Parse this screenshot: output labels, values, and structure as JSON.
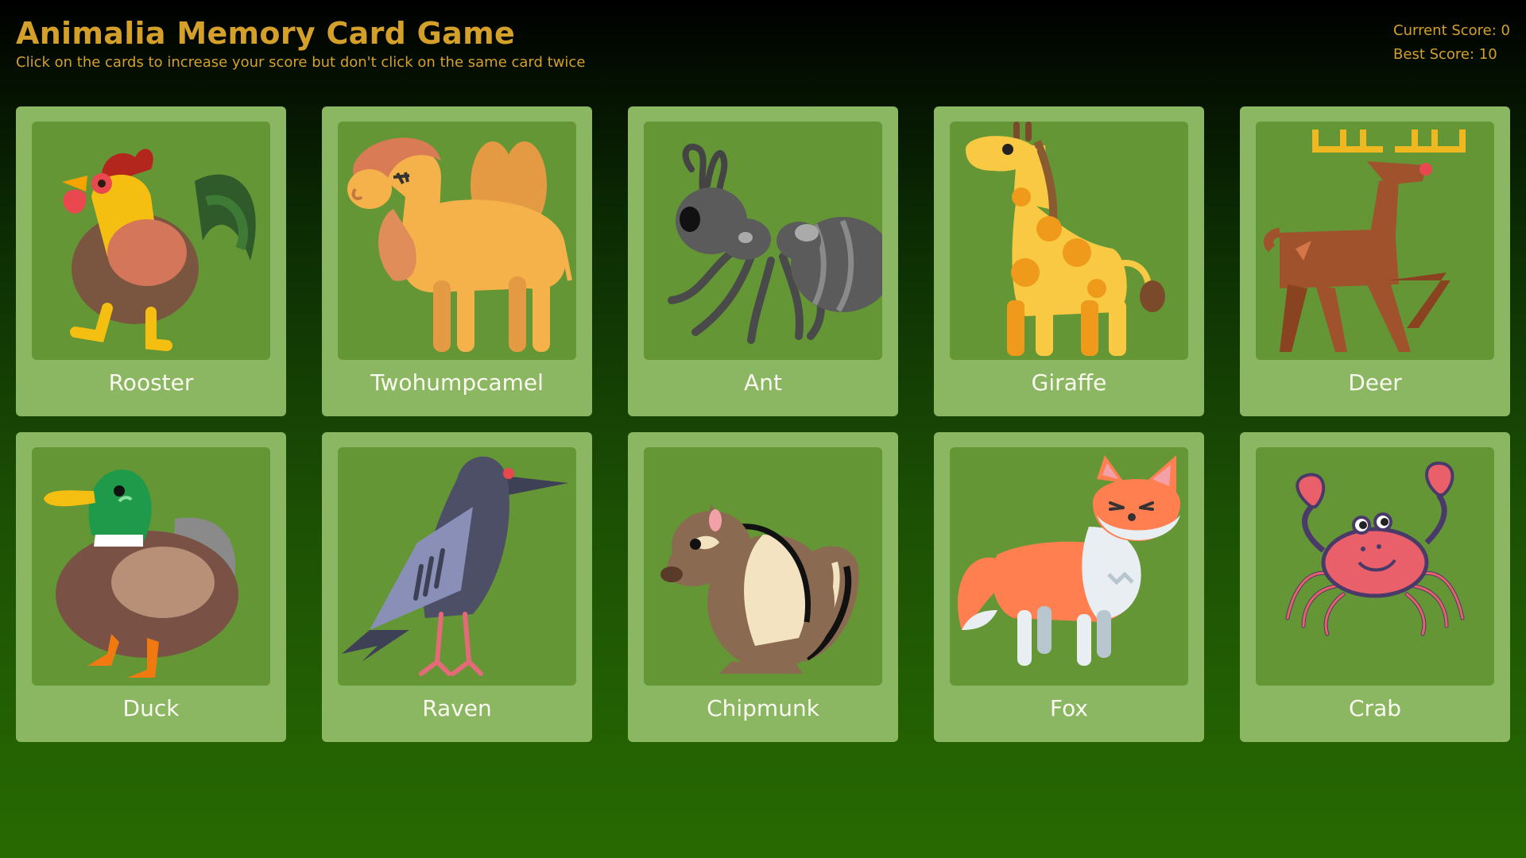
{
  "header": {
    "title": "Animalia Memory Card Game",
    "subtitle": "Click on the cards to increase your score but don't click on the same card twice"
  },
  "scores": {
    "current_label": "Current Score: 0",
    "best_label": "Best Score: 10",
    "current": 0,
    "best": 10
  },
  "cards": [
    {
      "label": "Rooster",
      "icon": "rooster-icon"
    },
    {
      "label": "Twohumpcamel",
      "icon": "camel-icon"
    },
    {
      "label": "Ant",
      "icon": "ant-icon"
    },
    {
      "label": "Giraffe",
      "icon": "giraffe-icon"
    },
    {
      "label": "Deer",
      "icon": "deer-icon"
    },
    {
      "label": "Duck",
      "icon": "duck-icon"
    },
    {
      "label": "Raven",
      "icon": "raven-icon"
    },
    {
      "label": "Chipmunk",
      "icon": "chipmunk-icon"
    },
    {
      "label": "Fox",
      "icon": "fox-icon"
    },
    {
      "label": "Crab",
      "icon": "crab-icon"
    }
  ],
  "colors": {
    "title": "#d4a02a",
    "card": "#8bb662",
    "card_image_bg": "#659636",
    "label": "#fafaf0"
  }
}
